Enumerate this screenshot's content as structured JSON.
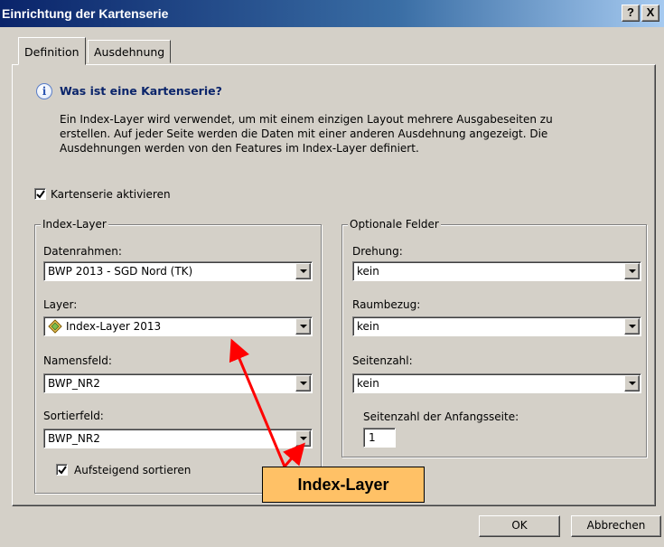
{
  "window": {
    "title": "Einrichtung der Kartenserie",
    "help_label": "?",
    "close_label": "X"
  },
  "tabs": [
    {
      "label": "Definition",
      "active": true
    },
    {
      "label": "Ausdehnung",
      "active": false
    }
  ],
  "info": {
    "icon": "info-icon",
    "icon_glyph": "i",
    "heading": "Was ist eine Kartenserie?",
    "lines": [
      "Ein Index-Layer wird verwendet, um mit einem einzigen Layout mehrere Ausgabeseiten zu",
      "erstellen. Auf jeder Seite werden die Daten mit einer anderen Ausdehnung angezeigt. Die",
      "Ausdehnungen werden von den Features im Index-Layer definiert."
    ]
  },
  "enable_checkbox": {
    "label": "Kartenserie aktivieren",
    "checked": true
  },
  "index_layer_group": {
    "title": "Index-Layer",
    "datenrahmen": {
      "label": "Datenrahmen:",
      "value": "BWP 2013 - SGD Nord (TK)"
    },
    "layer": {
      "label": "Layer:",
      "value": "Index-Layer 2013",
      "icon": "polygon-layer-icon"
    },
    "namensfeld": {
      "label": "Namensfeld:",
      "value": "BWP_NR2"
    },
    "sortierfeld": {
      "label": "Sortierfeld:",
      "value": "BWP_NR2"
    },
    "sort_ascending": {
      "label": "Aufsteigend sortieren",
      "checked": true
    }
  },
  "optional_group": {
    "title": "Optionale Felder",
    "drehung": {
      "label": "Drehung:",
      "value": "kein"
    },
    "raumbezug": {
      "label": "Raumbezug:",
      "value": "kein"
    },
    "seitenzahl": {
      "label": "Seitenzahl:",
      "value": "kein"
    },
    "start_page": {
      "label": "Seitenzahl der Anfangsseite:",
      "value": "1"
    }
  },
  "buttons": {
    "ok": "OK",
    "cancel": "Abbrechen"
  },
  "annotation": {
    "label": "Index-Layer",
    "color": "#ff0000",
    "fill": "#ffc166"
  }
}
